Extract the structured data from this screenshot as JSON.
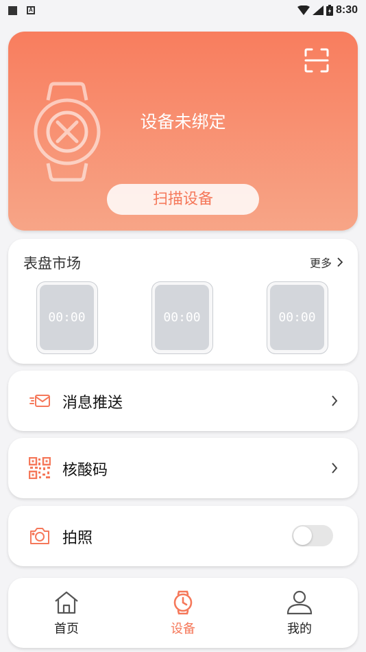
{
  "status_bar": {
    "time": "8:30"
  },
  "device": {
    "status_text": "设备未绑定",
    "scan_button_label": "扫描设备"
  },
  "market": {
    "title": "表盘市场",
    "more_label": "更多",
    "faces": [
      {
        "time": "00:00"
      },
      {
        "time": "00:00"
      },
      {
        "time": "00:00"
      }
    ]
  },
  "menu": {
    "message_push": "消息推送",
    "nucleic_code": "核酸码",
    "camera": "拍照",
    "camera_enabled": false
  },
  "tabs": [
    {
      "label": "首页",
      "icon": "home-icon",
      "active": false
    },
    {
      "label": "设备",
      "icon": "watch-icon",
      "active": true
    },
    {
      "label": "我的",
      "icon": "user-icon",
      "active": false
    }
  ],
  "colors": {
    "accent": "#f5785a",
    "gradient_top": "#f87d5e",
    "gradient_bottom": "#f7a587"
  }
}
